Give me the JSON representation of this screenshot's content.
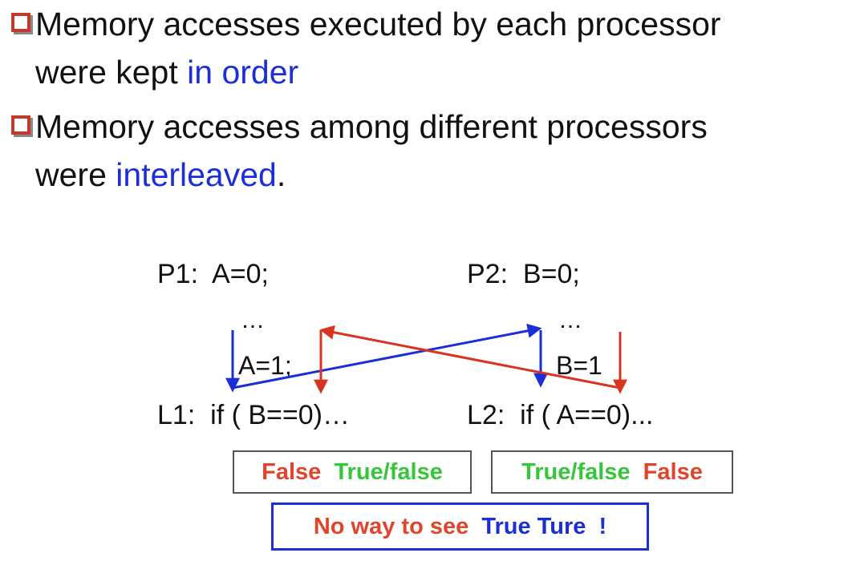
{
  "bullets": [
    {
      "line1": "Memory accesses executed by each processor",
      "line2_plain": "were kept ",
      "line2_highlight": "in order",
      "line2_tail": ""
    },
    {
      "line1": "Memory accesses among different processors",
      "line2_plain": "were ",
      "line2_highlight": "interleaved",
      "line2_tail": "."
    }
  ],
  "p1": {
    "first_stmt": "P1:  A=0;",
    "ellipsis": "…",
    "second_stmt": "A=1;",
    "branch": "L1:  if ( B==0)…"
  },
  "p2": {
    "first_stmt": "P2:  B=0;",
    "ellipsis": "…",
    "second_stmt": "B=1",
    "branch": "L2:  if ( A==0)..."
  },
  "results": {
    "left": {
      "red": "False",
      "green": "True/false"
    },
    "right": {
      "green": "True/false",
      "red": "False"
    }
  },
  "conclusion": {
    "red_text": "No way to see",
    "blue_text": "True Ture  !"
  },
  "colors": {
    "red": "#e0442a",
    "green": "#36c63a",
    "blue": "#1a2fd6",
    "bullet_box": "#c0392b",
    "arrow_red": "#d9341f",
    "arrow_blue": "#1a2fd6"
  }
}
